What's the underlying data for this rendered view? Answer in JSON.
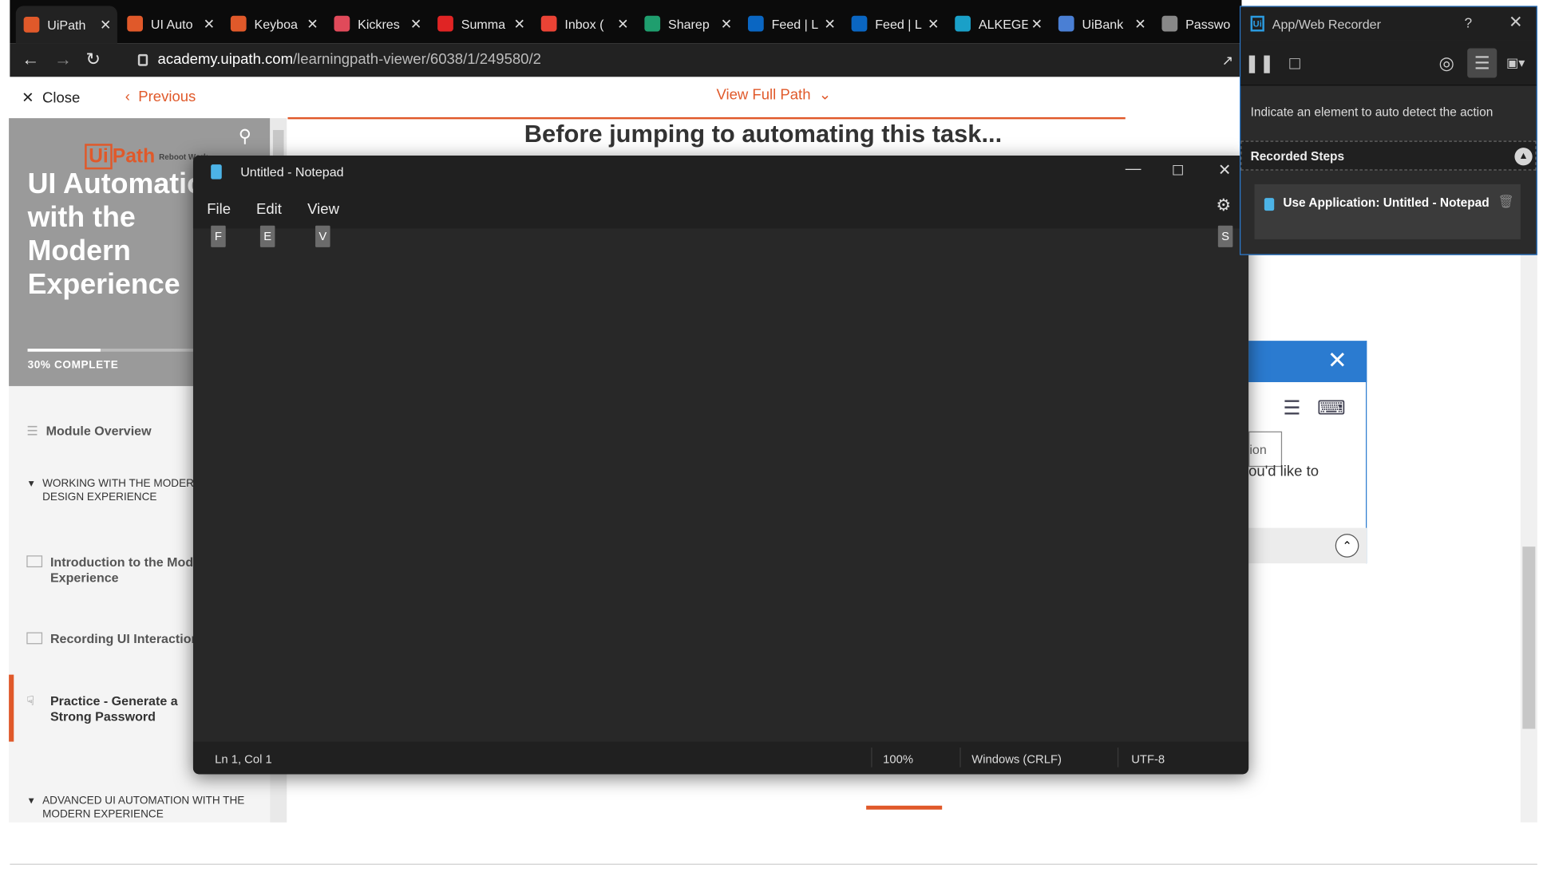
{
  "browser": {
    "tabs": [
      {
        "label": "UiPath",
        "icon": "uipath-icon",
        "color": "#e0592a"
      },
      {
        "label": "UI Auto",
        "icon": "uipath-icon",
        "color": "#e0592a"
      },
      {
        "label": "Keyboa",
        "icon": "uipath-icon",
        "color": "#e0592a"
      },
      {
        "label": "Kickres",
        "icon": "kickresume-icon",
        "color": "#e04a5a"
      },
      {
        "label": "Summa",
        "icon": "p-icon",
        "color": "#e02424"
      },
      {
        "label": "Inbox (",
        "icon": "gmail-icon",
        "color": "#ea4335"
      },
      {
        "label": "Sharep",
        "icon": "jh-icon",
        "color": "#1f9e6e"
      },
      {
        "label": "Feed | L",
        "icon": "linkedin-icon",
        "color": "#0a66c2"
      },
      {
        "label": "Feed | L",
        "icon": "linkedin-icon",
        "color": "#0a66c2"
      },
      {
        "label": "ALKEGE",
        "icon": "alkeg-icon",
        "color": "#1aa0c8"
      },
      {
        "label": "UiBank",
        "icon": "bank-icon",
        "color": "#4a7fd4"
      },
      {
        "label": "Passwo",
        "icon": "globe-icon",
        "color": "#888888"
      }
    ],
    "url_host": "academy.uipath.com",
    "url_path": "/learningpath-viewer/6038/1/249580/2"
  },
  "page": {
    "close_label": "Close",
    "previous_label": "Previous",
    "view_full_path": "View Full Path",
    "heading": "Before jumping to automating this task...",
    "accent_color": "#e0592a"
  },
  "sidebar": {
    "logo": "UiPath",
    "logo_box": "Ui",
    "logo_rest": "Path",
    "logo_tag": "Reboot Work.",
    "course_title_lines": [
      "UI Automation",
      "with the",
      "Modern",
      "Experience"
    ],
    "progress_fraction": 0.3,
    "progress_label": "30% COMPLETE",
    "items": [
      {
        "label": "Module Overview"
      },
      {
        "label": "WORKING WITH THE MODERN DESIGN EXPERIENCE"
      },
      {
        "label": "Introduction to the Modern Experience"
      },
      {
        "label": "Recording UI Interactions"
      },
      {
        "label": "Practice - Generate a Strong Password"
      },
      {
        "label": "ADVANCED UI AUTOMATION WITH THE MODERN EXPERIENCE"
      }
    ]
  },
  "background_dialog": {
    "tooltip": "ion",
    "text": "ou'd like to"
  },
  "notepad": {
    "title": "Untitled - Notepad",
    "menu": [
      "File",
      "Edit",
      "View"
    ],
    "keytips": [
      "F",
      "E",
      "V",
      "S"
    ],
    "status": {
      "position": "Ln 1, Col 1",
      "zoom": "100%",
      "line_endings": "Windows (CRLF)",
      "encoding": "UTF-8"
    }
  },
  "recorder": {
    "title": "App/Web Recorder",
    "help": "?",
    "hint": "Indicate an element to auto detect the action",
    "steps_header": "Recorded Steps",
    "steps": [
      {
        "label": "Use Application: Untitled - Notepad"
      }
    ]
  }
}
